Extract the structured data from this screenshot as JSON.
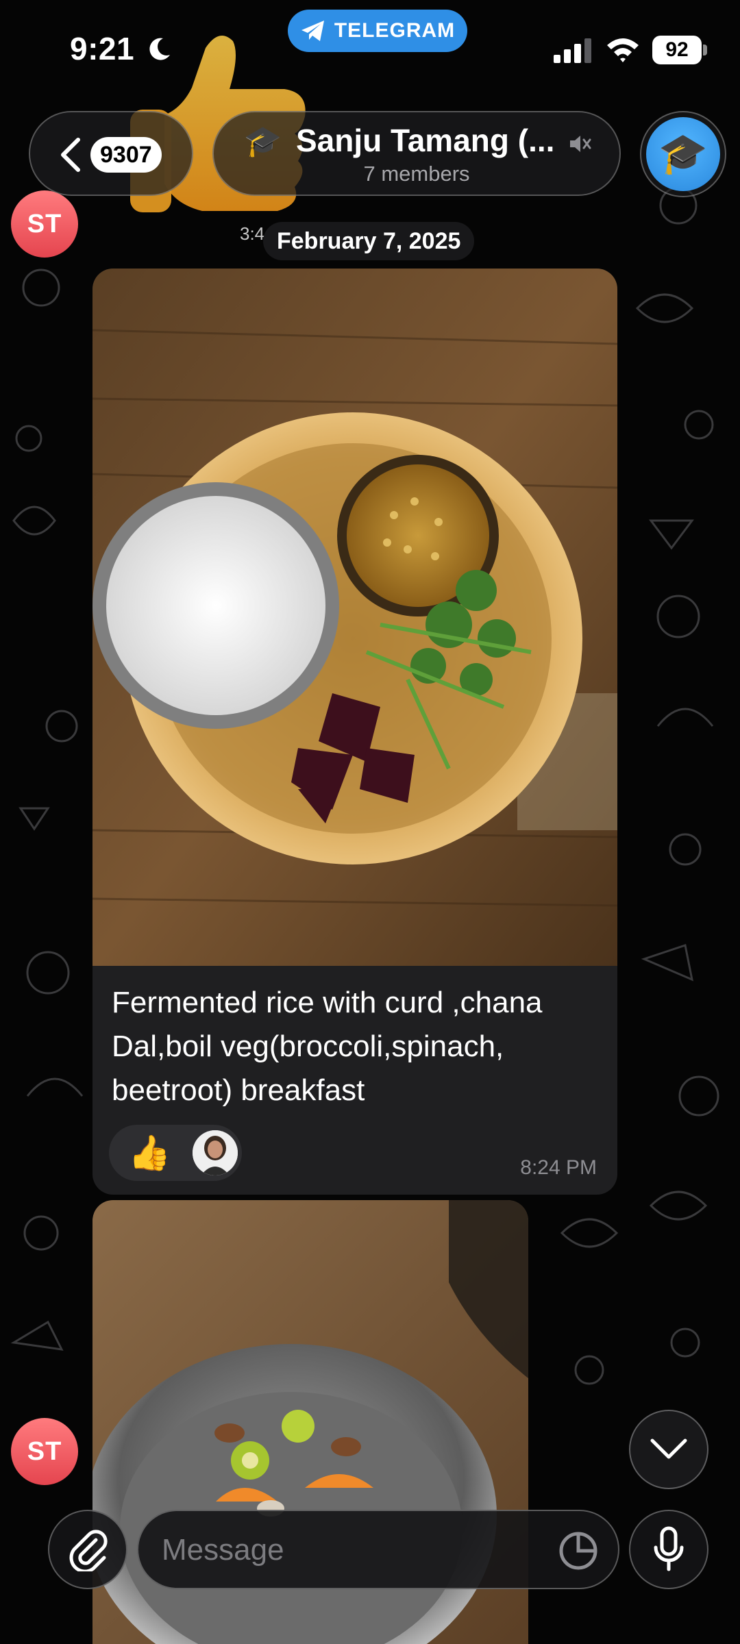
{
  "status_bar": {
    "time": "9:21",
    "app_pill": "TELEGRAM",
    "battery": "92"
  },
  "header": {
    "back_count": "9307",
    "title": "Sanju Tamang (...",
    "subtitle": "7 members",
    "title_icon": "🎓",
    "avatar_icon": "🎓"
  },
  "chat": {
    "sender_initials": "ST",
    "date": "February 7, 2025",
    "faded_time": "3:4",
    "messages": [
      {
        "caption": "Fermented rice with curd ,chana Dal,boil veg(broccoli,spinach, beetroot) breakfast",
        "time": "8:24 PM",
        "reaction_emoji": "👍"
      }
    ]
  },
  "composer": {
    "placeholder": "Message"
  },
  "colors": {
    "accent": "#2f8fe6",
    "avatar_red": "#ec5460",
    "bubble": "#1f1f21"
  }
}
